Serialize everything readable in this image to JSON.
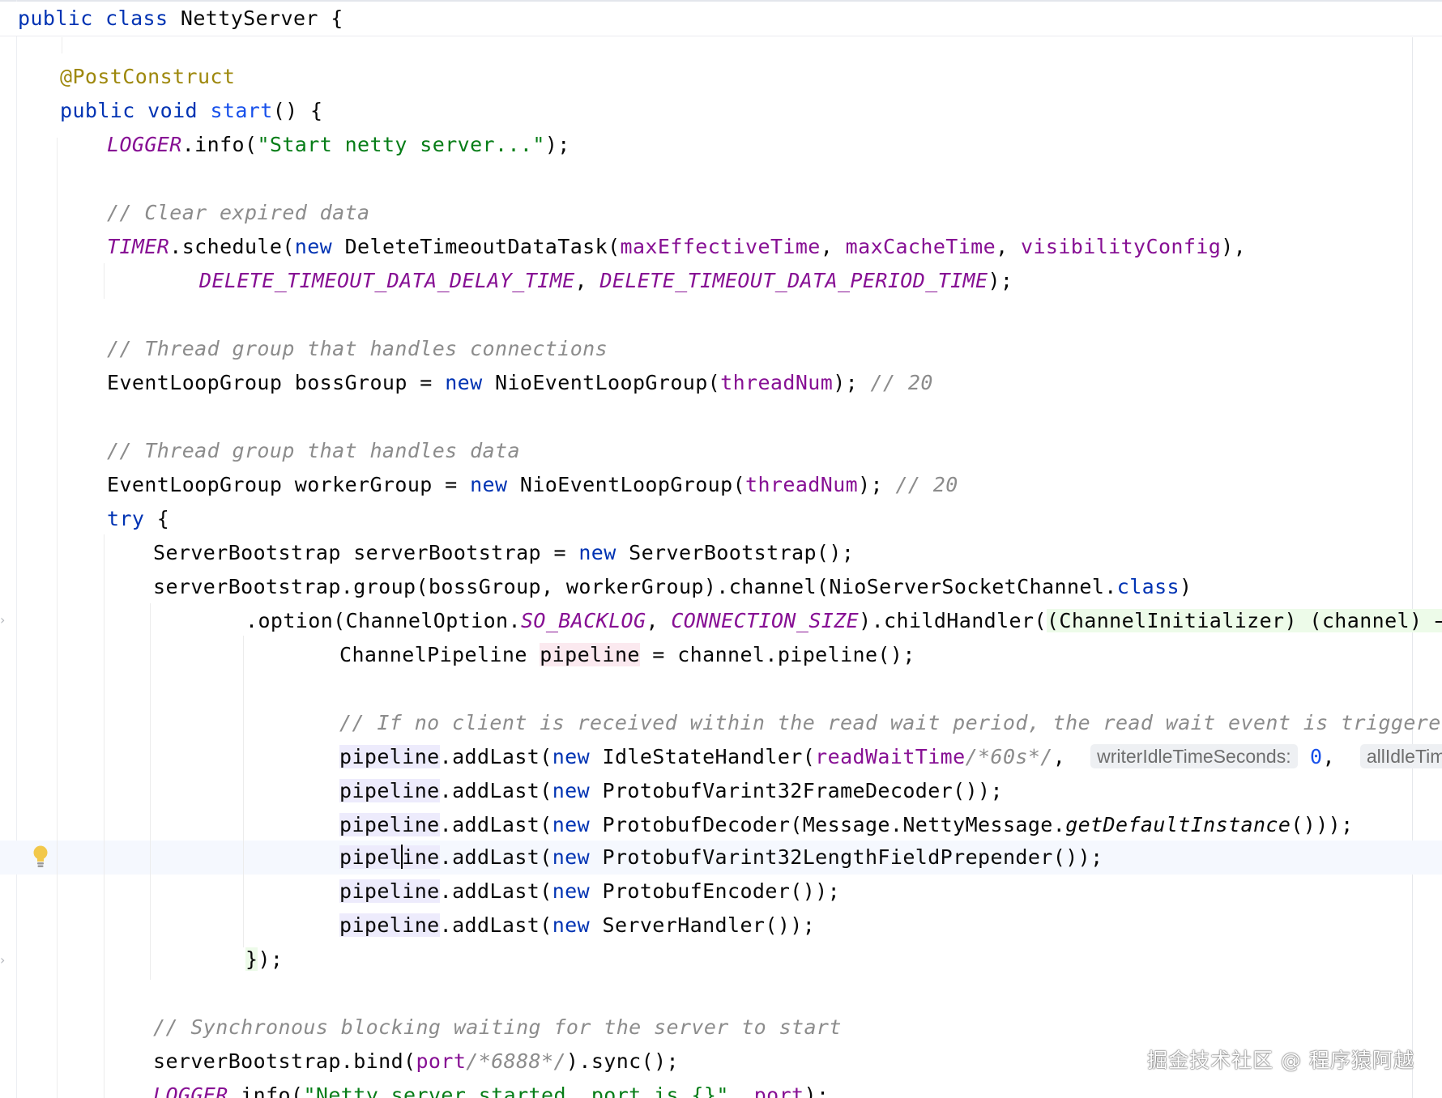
{
  "editor": {
    "sticky_header": {
      "kw_public": "public",
      "kw_class": "class",
      "class_name": "NettyServer",
      "brace": " {"
    },
    "lines": {
      "annotation": "@PostConstruct",
      "start_decl": {
        "public": "public",
        "void": "void",
        "name": "start",
        "rest": "() {"
      },
      "logger_start": {
        "const": "LOGGER",
        "call": ".info(",
        "str": "\"Start netty server...\"",
        "end": ");"
      },
      "comment_clear": "// Clear expired data",
      "timer_line": {
        "const": "TIMER",
        "call": ".schedule(",
        "new": "new",
        "cls": " DeleteTimeoutDataTask(",
        "p1": "maxEffectiveTime",
        "sep1": ", ",
        "p2": "maxCacheTime",
        "sep2": ", ",
        "p3": "visibilityConfig",
        "end": "),"
      },
      "timer_cont": {
        "c1": "DELETE_TIMEOUT_DATA_DELAY_TIME",
        "sep": ", ",
        "c2": "DELETE_TIMEOUT_DATA_PERIOD_TIME",
        "end": ");"
      },
      "comment_conn": "// Thread group that handles connections",
      "boss_line": {
        "decl": "EventLoopGroup bossGroup = ",
        "new": "new",
        "cls": " NioEventLoopGroup(",
        "param": "threadNum",
        "end": "); ",
        "cmt": "// 20"
      },
      "comment_data": "// Thread group that handles data",
      "worker_line": {
        "decl": "EventLoopGroup workerGroup = ",
        "new": "new",
        "cls": " NioEventLoopGroup(",
        "param": "threadNum",
        "end": "); ",
        "cmt": "// 20"
      },
      "try_line": {
        "kw": "try",
        "rest": " {"
      },
      "bootstrap_decl": {
        "decl": "ServerBootstrap serverBootstrap = ",
        "new": "new",
        "rest": " ServerBootstrap();"
      },
      "group_line": {
        "text": "serverBootstrap.group(bossGroup, workerGroup).channel(NioServerSocketChannel.",
        "kw": "class",
        "end": ")"
      },
      "option_line": {
        "a": ".option(ChannelOption.",
        "c1": "SO_BACKLOG",
        "sep": ", ",
        "c2": "CONNECTION_SIZE",
        "b": ").childHandler(",
        "lambda": "(ChannelInitializer) (channel) → {"
      },
      "pipeline_decl": {
        "a": "ChannelPipeline ",
        "var": "pipeline",
        "b": " = channel.pipeline();"
      },
      "comment_idle": "// If no client is received within the read wait period, the read wait event is triggered",
      "idle_line": {
        "var": "pipeline",
        "a": ".addLast(",
        "new": "new",
        "b": " IdleStateHandler(",
        "param": "readWaitTime",
        "cmt": "/*60s*/",
        "sep": ", ",
        "hint1": "writerIdleTimeSeconds:",
        "num": "0",
        "sep2": ", ",
        "hint2": "allIdleTimeSecon"
      },
      "add_frame_decoder": {
        "var": "pipeline",
        "a": ".addLast(",
        "new": "new",
        "b": " ProtobufVarint32FrameDecoder());"
      },
      "add_decoder": {
        "var": "pipeline",
        "a": ".addLast(",
        "new": "new",
        "b": " ProtobufDecoder(Message.NettyMessage.",
        "method": "getDefaultInstance",
        "c": "()));"
      },
      "add_prepender": {
        "var1": "pipel",
        "var2": "ine",
        "a": ".addLast(",
        "new": "new",
        "b": " ProtobufVarint32LengthFieldPrepender());"
      },
      "add_encoder": {
        "var": "pipeline",
        "a": ".addLast(",
        "new": "new",
        "b": " ProtobufEncoder());"
      },
      "add_handler": {
        "var": "pipeline",
        "a": ".addLast(",
        "new": "new",
        "b": " ServerHandler());"
      },
      "lambda_close": {
        "brace": "}",
        "rest": ");"
      },
      "comment_sync": "// Synchronous blocking waiting for the server to start",
      "bind_line": {
        "a": "serverBootstrap.bind(",
        "param": "port",
        "cmt": "/*6888*/",
        "b": ").sync();"
      },
      "logger_started": {
        "const": "LOGGER",
        "a": ".info(",
        "str": "\"Netty server started, port is {}\"",
        "sep": ", ",
        "param": "port",
        "b": ");"
      }
    },
    "icons": {
      "bulb": "lightbulb-icon",
      "fold": "fold-arrow-icon",
      "warning": "warning-icon"
    },
    "watermark": "掘金技术社区 @ 程序猿阿越",
    "colors": {
      "keyword": "#0033b3",
      "string": "#067d17",
      "comment": "#8c8c8c",
      "constant": "#871094",
      "annotation": "#9e880d",
      "number": "#1750eb"
    }
  }
}
